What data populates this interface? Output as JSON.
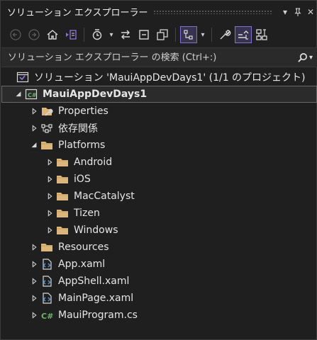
{
  "panel": {
    "title": "ソリューション エクスプローラー",
    "search_placeholder": "ソリューション エクスプローラー の検索 (Ctrl+:)"
  },
  "titlebar_buttons": [
    {
      "name": "dropdown",
      "glyph": "▾"
    },
    {
      "name": "pin",
      "glyph": "⊥"
    },
    {
      "name": "close",
      "glyph": "✕"
    }
  ],
  "tree": [
    {
      "label": "ソリューション 'MauiAppDevDays1' (1/1 のプロジェクト)",
      "icon": "solution-icon",
      "level": 0,
      "arrow": "none"
    },
    {
      "label": "MauiAppDevDays1",
      "icon": "csharp-project-icon",
      "level": 0,
      "arrow": "expanded",
      "bold": true,
      "selected": true
    },
    {
      "label": "Properties",
      "icon": "properties-icon",
      "level": 1,
      "arrow": "collapsed"
    },
    {
      "label": "依存関係",
      "icon": "dependencies-icon",
      "level": 1,
      "arrow": "collapsed"
    },
    {
      "label": "Platforms",
      "icon": "folder-icon",
      "level": 1,
      "arrow": "expanded"
    },
    {
      "label": "Android",
      "icon": "folder-icon",
      "level": 2,
      "arrow": "collapsed"
    },
    {
      "label": "iOS",
      "icon": "folder-icon",
      "level": 2,
      "arrow": "collapsed"
    },
    {
      "label": "MacCatalyst",
      "icon": "folder-icon",
      "level": 2,
      "arrow": "collapsed"
    },
    {
      "label": "Tizen",
      "icon": "folder-icon",
      "level": 2,
      "arrow": "collapsed"
    },
    {
      "label": "Windows",
      "icon": "folder-icon",
      "level": 2,
      "arrow": "collapsed"
    },
    {
      "label": "Resources",
      "icon": "folder-icon",
      "level": 1,
      "arrow": "collapsed"
    },
    {
      "label": "App.xaml",
      "icon": "xaml-icon",
      "level": 1,
      "arrow": "collapsed"
    },
    {
      "label": "AppShell.xaml",
      "icon": "xaml-icon",
      "level": 1,
      "arrow": "collapsed"
    },
    {
      "label": "MainPage.xaml",
      "icon": "xaml-icon",
      "level": 1,
      "arrow": "collapsed"
    },
    {
      "label": "MauiProgram.cs",
      "icon": "csharp-file-icon",
      "level": 1,
      "arrow": "collapsed"
    }
  ],
  "colors": {
    "background": "#1f1f1f",
    "folder": "#dcb67a",
    "csharp": "#6bb36b",
    "vs_purple": "#8b6fd6",
    "selection_border": "#7f71d6"
  }
}
